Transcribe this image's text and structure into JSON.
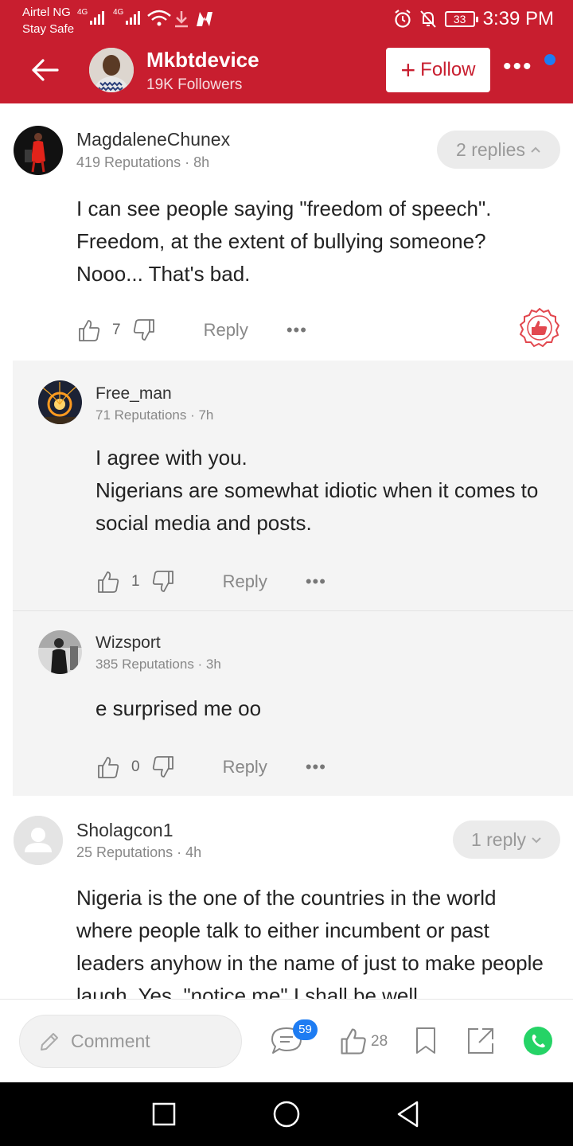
{
  "status_bar": {
    "carrier": "Airtel NG",
    "carrier_sub": "Stay Safe",
    "network1": "4G",
    "network2": "4G",
    "battery": "33",
    "time": "3:39 PM"
  },
  "header": {
    "author_name": "Mkbtdevice",
    "followers": "19K Followers",
    "follow_label": "Follow",
    "more": "•••"
  },
  "comments": [
    {
      "user": "MagdaleneChunex",
      "meta": "419 Reputations · 8h",
      "text": "I can see people saying \"freedom of speech\". Freedom, at the extent of bullying someone? Nooo... That's bad.",
      "likes": "7",
      "reply_label": "Reply",
      "replies_toggle": "2 replies"
    },
    {
      "user": "Free_man",
      "meta": "71 Reputations · 7h",
      "text_lines": [
        "I agree with you.",
        "Nigerians are somewhat idiotic when it comes to social media and posts."
      ],
      "likes": "1",
      "reply_label": "Reply"
    },
    {
      "user": "Wizsport",
      "meta": "385 Reputations · 3h",
      "text": "e surprised me oo",
      "likes": "0",
      "reply_label": "Reply"
    },
    {
      "user": "Sholagcon1",
      "meta": "25 Reputations · 4h",
      "text": "Nigeria is the one of the countries in the world where people talk to either incumbent or past leaders anyhow in the name of just to make people laugh. Yes, \"notice me\" I shall be well",
      "replies_toggle": "1 reply"
    }
  ],
  "bottom_bar": {
    "comment_placeholder": "Comment",
    "comment_count": "59",
    "like_count": "28"
  },
  "colors": {
    "brand": "#c81e2f",
    "accent": "#1e7cf2",
    "whatsapp": "#25d366"
  }
}
